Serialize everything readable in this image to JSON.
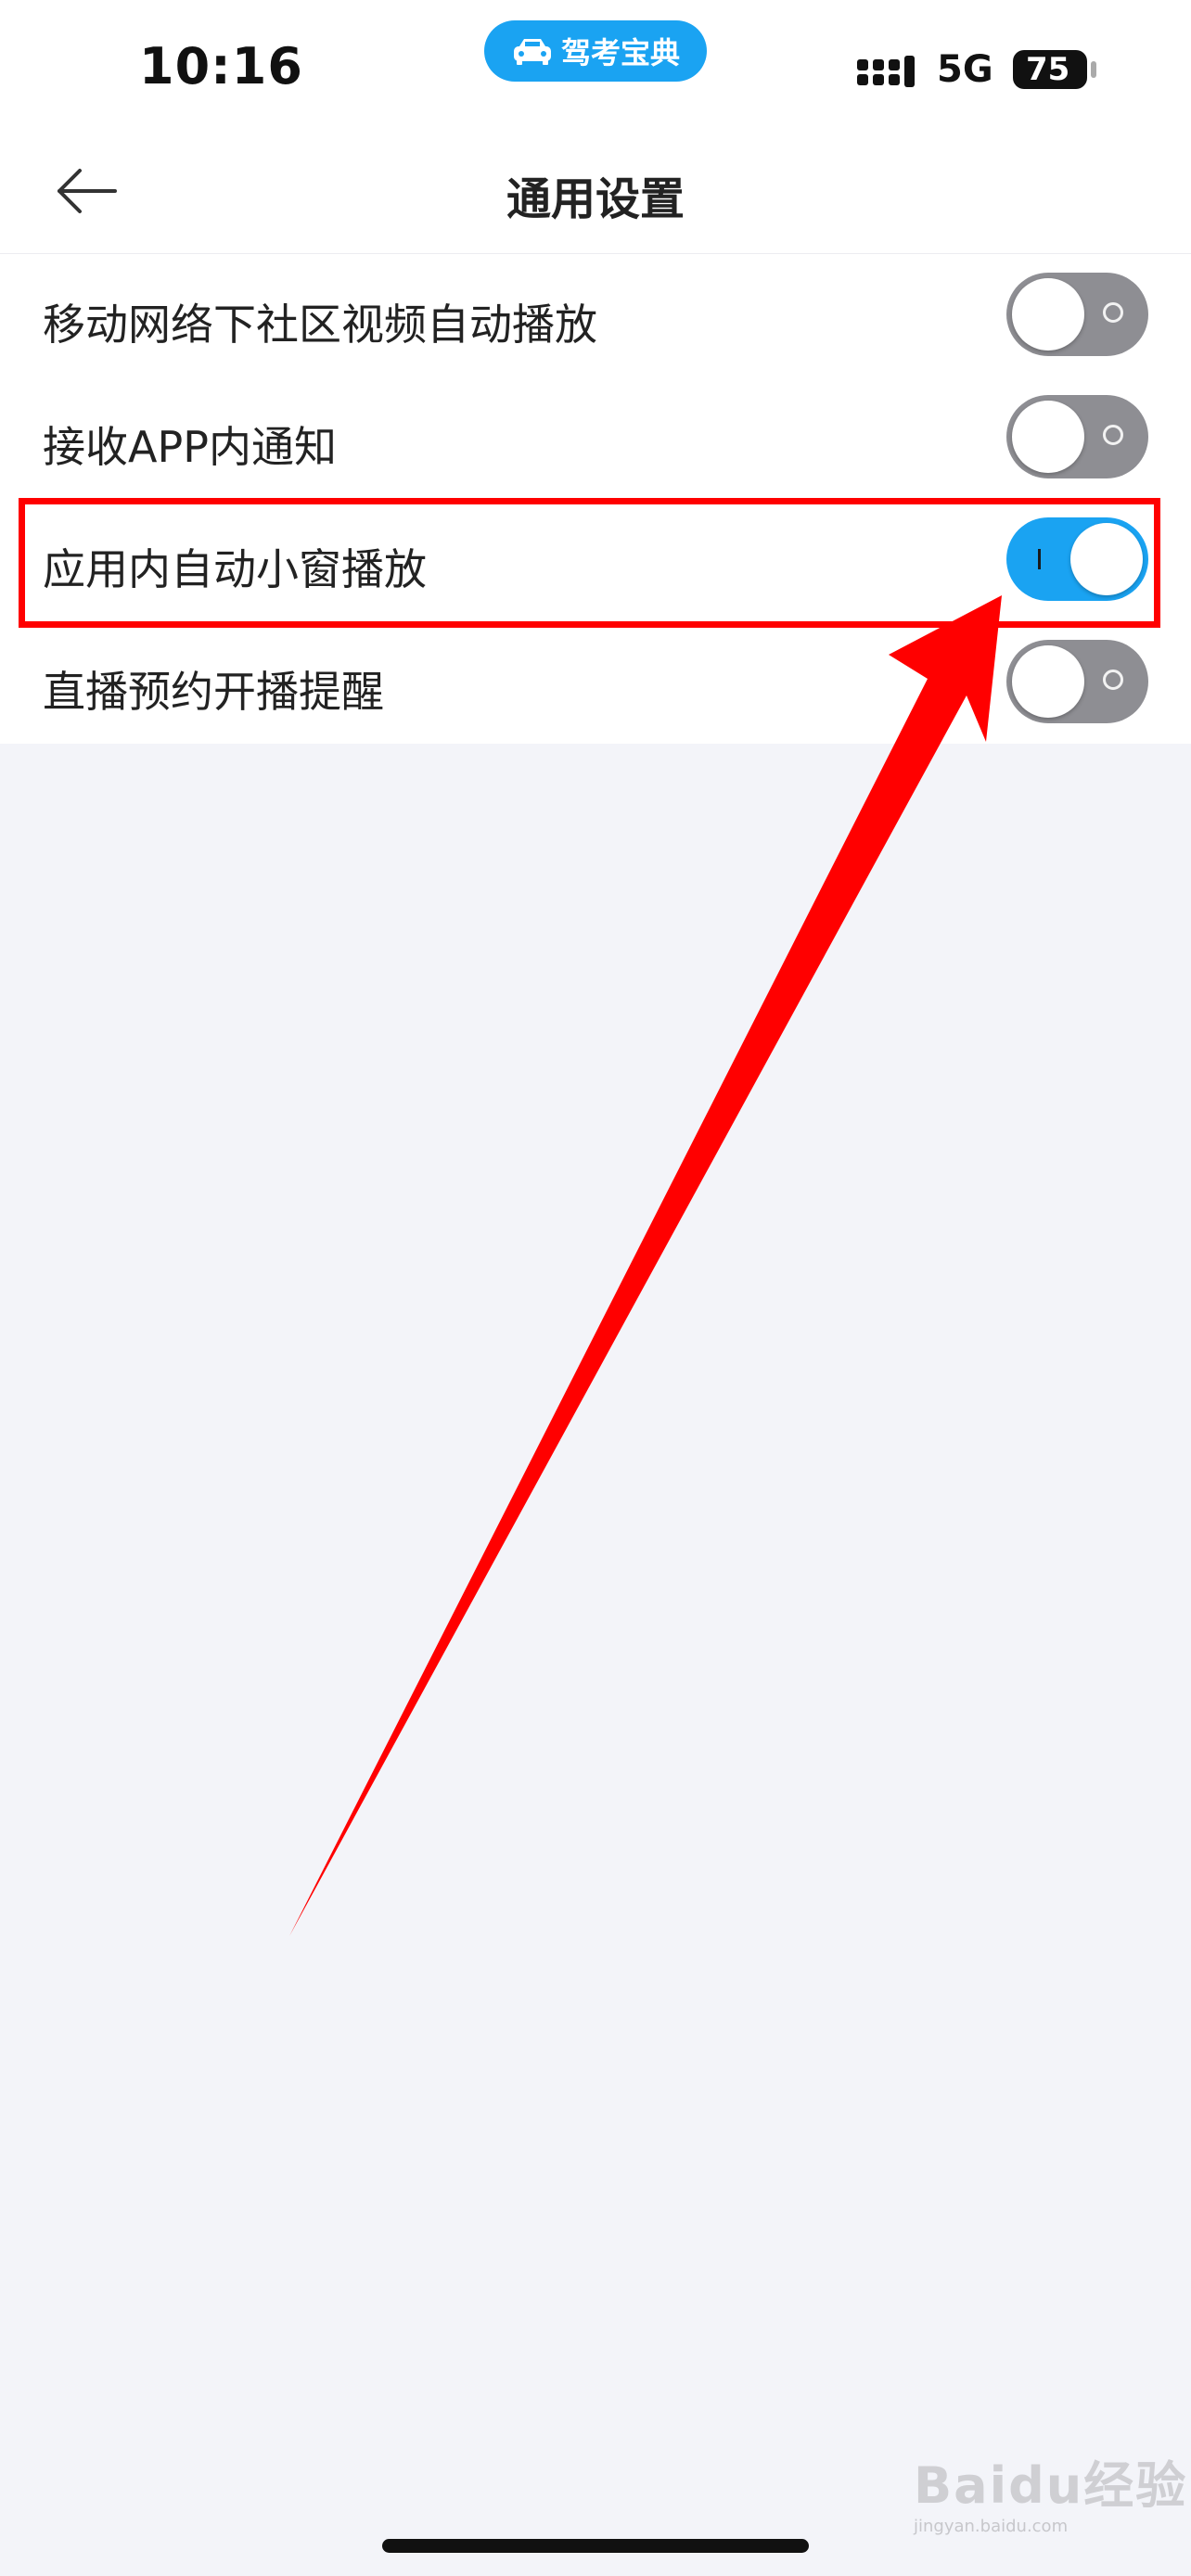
{
  "status_bar": {
    "time": "10:16",
    "app_badge": "驾考宝典",
    "network": "5G",
    "battery": "75"
  },
  "nav": {
    "title": "通用设置",
    "back_icon": "arrow-left-icon"
  },
  "settings": [
    {
      "label": "移动网络下社区视频自动播放",
      "enabled": false
    },
    {
      "label": "接收APP内通知",
      "enabled": false
    },
    {
      "label": "应用内自动小窗播放",
      "enabled": true
    },
    {
      "label": "直播预约开播提醒",
      "enabled": false
    }
  ],
  "colors": {
    "toggle_on": "#1aa3f2",
    "toggle_off": "#8e8e93",
    "annotation": "#ff0000"
  },
  "watermark": {
    "text": "Baidu经验",
    "sub": "jingyan.baidu.com"
  }
}
